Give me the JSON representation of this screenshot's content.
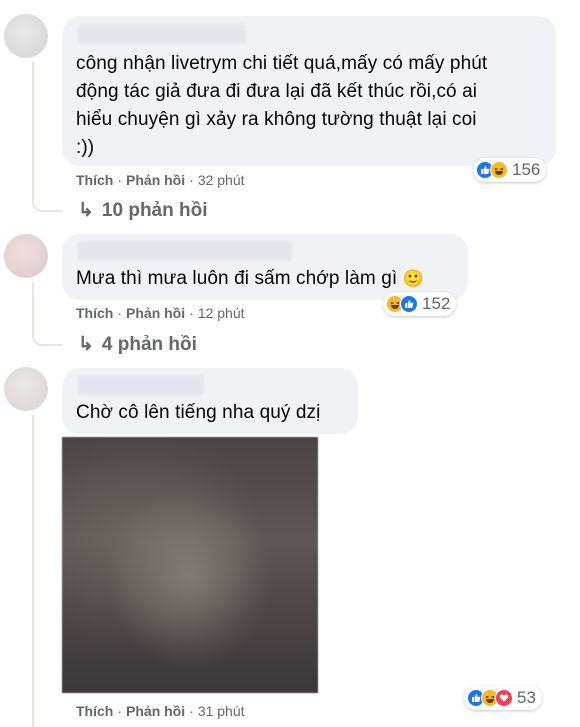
{
  "comments": [
    {
      "text_lines": [
        "công nhận livetrym chi tiết quá,mấy có mấy phút",
        "động tác giả đưa đi đưa lại đã kết thúc rồi,có ai",
        "hiểu chuyện gì xảy ra không tường thuật lại coi",
        ":))"
      ],
      "like_label": "Thích",
      "reply_label": "Phản hồi",
      "time": "32 phút",
      "reaction_count": "156",
      "replies_label": "10 phản hồi"
    },
    {
      "text": "Mưa thì mưa luôn đi sấm chớp làm gì",
      "emoji": "🙂",
      "like_label": "Thích",
      "reply_label": "Phản hồi",
      "time": "12 phút",
      "reaction_count": "152",
      "replies_label": "4 phản hồi"
    },
    {
      "text": "Chờ cô lên tiếng nha quý dzị",
      "like_label": "Thích",
      "reply_label": "Phản hồi",
      "time": "31 phút",
      "reaction_count": "53"
    }
  ],
  "separator": "·",
  "reply_arrow": "↳",
  "icons": {
    "like": "like-reaction-icon",
    "haha": "haha-reaction-icon",
    "love": "love-reaction-icon",
    "reply_arrow": "reply-arrow-icon"
  },
  "colors": {
    "bubble": "#f0f2f5",
    "meta_text": "#65676b",
    "like_blue": "#1877f2",
    "haha_yellow": "#f7b928",
    "love_red": "#f33e58"
  }
}
